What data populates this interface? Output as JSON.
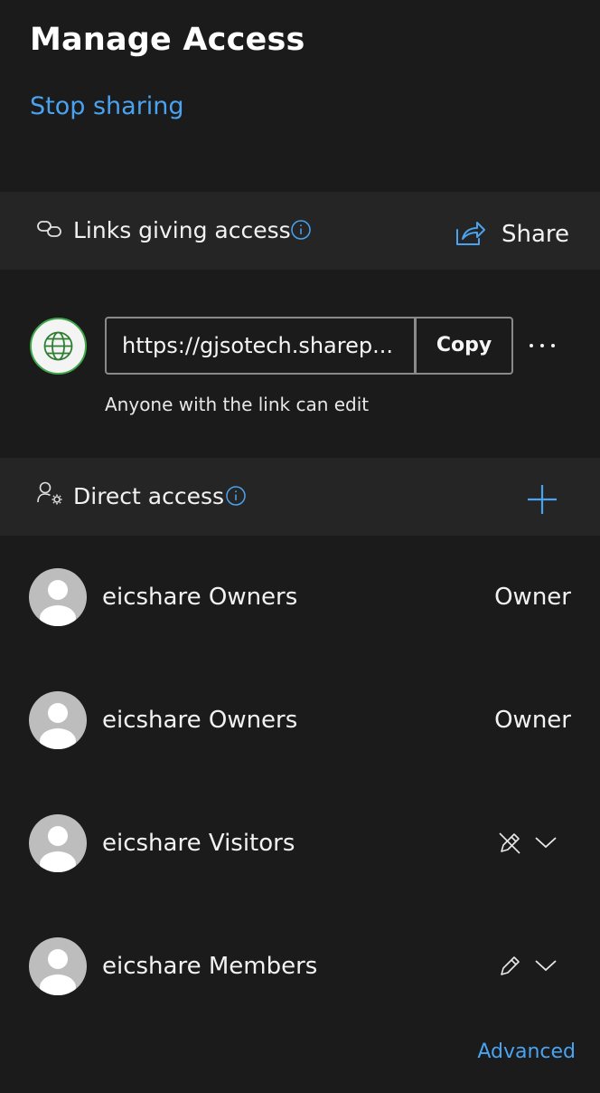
{
  "header": {
    "title": "Manage Access",
    "stop_sharing": "Stop sharing"
  },
  "links_section": {
    "label": "Links giving access",
    "share_label": "Share",
    "link": {
      "url": "https://gjsotech.sharep...",
      "copy_label": "Copy",
      "description": "Anyone with the link can edit"
    }
  },
  "direct_section": {
    "label": "Direct access",
    "members": [
      {
        "name": "eicshare Owners",
        "role": "Owner"
      },
      {
        "name": "eicshare Owners",
        "role": "Owner"
      },
      {
        "name": "eicshare Visitors",
        "permission_icon": "no-edit-icon"
      },
      {
        "name": "eicshare Members",
        "permission_icon": "pencil-icon"
      }
    ]
  },
  "footer": {
    "advanced": "Advanced"
  },
  "colors": {
    "background": "#1b1b1b",
    "band": "#252525",
    "accent": "#4aa3f0",
    "globe_border": "#3fa74a"
  }
}
